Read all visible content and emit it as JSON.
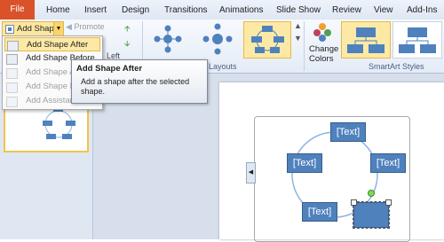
{
  "tabs": [
    {
      "label": "File"
    },
    {
      "label": "Home"
    },
    {
      "label": "Insert"
    },
    {
      "label": "Design"
    },
    {
      "label": "Transitions"
    },
    {
      "label": "Animations"
    },
    {
      "label": "Slide Show"
    },
    {
      "label": "Review"
    },
    {
      "label": "View"
    },
    {
      "label": "Add-Ins"
    }
  ],
  "create_graphic": {
    "add_shape_label": "Add Shape",
    "promote_label": "Promote",
    "right_to_left_label": "Left"
  },
  "dropdown": {
    "items": [
      {
        "label": "Add Shape After",
        "state": "hover"
      },
      {
        "label": "Add Shape Before",
        "state": "enabled"
      },
      {
        "label": "Add Shape Ab",
        "state": "disabled"
      },
      {
        "label": "Add Shape Be",
        "state": "disabled"
      },
      {
        "label": "Add Assistant",
        "state": "disabled"
      }
    ]
  },
  "tooltip": {
    "title": "Add Shape After",
    "body": "Add a shape after the selected shape."
  },
  "layouts": {
    "group_label": "Layouts"
  },
  "change_colors": {
    "label_line1": "Change",
    "label_line2": "Colors"
  },
  "smartart_styles": {
    "group_label": "SmartArt Styles"
  },
  "diagram": {
    "nodes": [
      {
        "text": "[Text]"
      },
      {
        "text": "[Text]"
      },
      {
        "text": "[Text]"
      },
      {
        "text": "[Text]"
      },
      {
        "text": ""
      }
    ]
  },
  "colors": {
    "file_tab": "#d9522a",
    "highlight": "#fde9a6",
    "node_fill": "#4f81bd",
    "circle_stroke": "#8eb4e3"
  }
}
